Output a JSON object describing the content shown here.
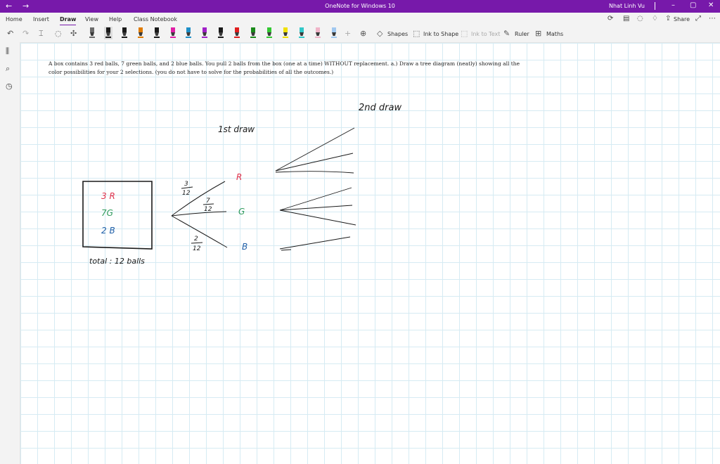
{
  "titlebar": {
    "back_icon": "←",
    "forward_icon": "→",
    "title": "OneNote for Windows 10",
    "user": "Nhat Linh Vu",
    "minimize": "–",
    "maximize": "▢",
    "close": "✕"
  },
  "menu": {
    "tabs": [
      "Home",
      "Insert",
      "Draw",
      "View",
      "Help",
      "Class Notebook"
    ],
    "active": "Draw",
    "share": "Share"
  },
  "toolbar": {
    "shapes": "Shapes",
    "ink_to_shape": "Ink to Shape",
    "ink_to_text": "Ink to Text",
    "ruler": "Ruler",
    "maths": "Maths",
    "pen_colors": [
      "#6b6b6b",
      "#1a1a1a",
      "#1a1a1a",
      "#e07b00",
      "#1a1a1a",
      "#e01ea6",
      "#1e90c8",
      "#a020c8",
      "#1a1a1a",
      "#e01e1e",
      "#1a8a1a",
      "#32c832",
      "#f0e000",
      "#32c8c8",
      "#f0b4c8",
      "#a0c8f0"
    ],
    "selected_pen": 1
  },
  "page": {
    "problem_text": "A box contains 3 red balls, 7 green balls, and 2 blue balls. You pull 2 balls from the box (one at a time) WITHOUT replacement. a.) Draw a tree diagram (neatly) showing all the color possibilities for your 2 selections. (you do not have to solve for the probabilities of all the outcomes.)"
  },
  "ink": {
    "second_draw_label": "2nd draw",
    "first_draw_label": "1st draw",
    "box_red": "3 R",
    "box_green": "7G",
    "box_blue": "2 B",
    "total": "total : 12 balls",
    "branch_red_num": "3",
    "branch_red_den": "12",
    "branch_green_num": "7",
    "branch_green_den": "12",
    "branch_blue_num": "2",
    "branch_blue_den": "12",
    "node_red": "R",
    "node_green": "G",
    "node_blue": "B",
    "colors": {
      "red": "#e0304a",
      "green": "#2e9a5a",
      "blue": "#1f5fa8",
      "ink": "#1a1a1a"
    }
  }
}
